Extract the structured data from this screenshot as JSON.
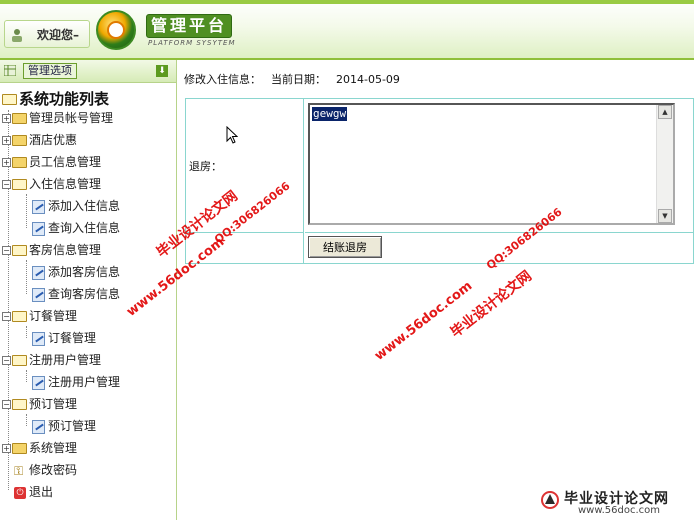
{
  "header": {
    "welcome": "欢迎您–",
    "brand_title": "管理平台",
    "brand_subtitle": "PLATFORM SYSYTEM"
  },
  "sidebar": {
    "menu_button": "管理选项",
    "root_title": "系统功能列表",
    "items": [
      {
        "label": "管理员帐号管理"
      },
      {
        "label": "酒店优惠"
      },
      {
        "label": "员工信息管理"
      },
      {
        "label": "入住信息管理"
      },
      {
        "label": "添加入住信息"
      },
      {
        "label": "查询入住信息"
      },
      {
        "label": "客房信息管理"
      },
      {
        "label": "添加客房信息"
      },
      {
        "label": "查询客房信息"
      },
      {
        "label": "订餐管理"
      },
      {
        "label": "订餐管理"
      },
      {
        "label": "注册用户管理"
      },
      {
        "label": "注册用户管理"
      },
      {
        "label": "预订管理"
      },
      {
        "label": "预订管理"
      },
      {
        "label": "系统管理"
      },
      {
        "label": "修改密码"
      },
      {
        "label": "退出"
      }
    ]
  },
  "main": {
    "heading": "修改入住信息：",
    "date_label": "当前日期：",
    "date_value": "2014-05-09",
    "checkout_label": "退房：",
    "textarea_value": "gewgw",
    "submit_label": "结账退房"
  },
  "watermarks": {
    "site_cn": "毕业设计论文网",
    "site_url": "www.56doc.com",
    "qq": "QQ:306826066"
  },
  "colors": {
    "accent_green": "#4f8f22",
    "table_border": "#8ad6cf",
    "watermark_red": "#e00000"
  }
}
